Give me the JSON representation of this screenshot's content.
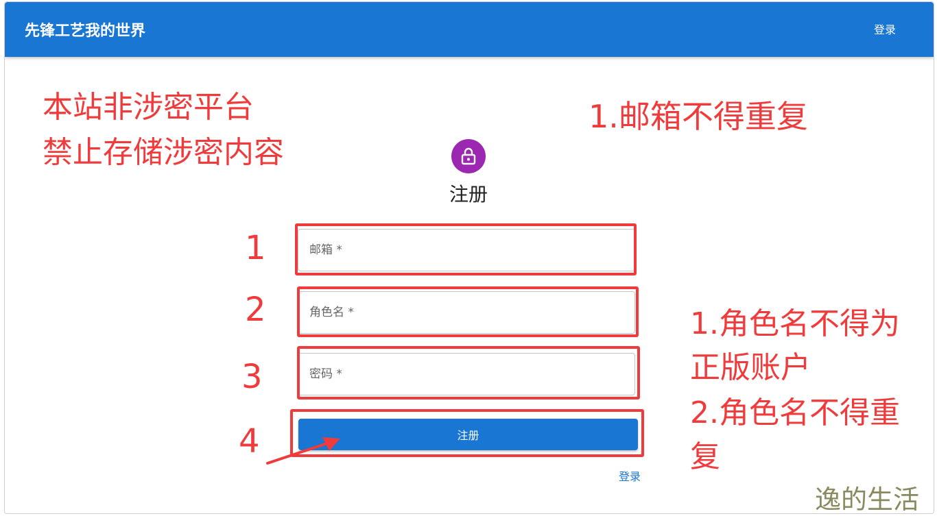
{
  "header": {
    "site_title": "先锋工艺我的世界",
    "login_link": "登录"
  },
  "form": {
    "title": "注册",
    "email_placeholder": "邮箱 *",
    "name_placeholder": "角色名 *",
    "password_placeholder": "密码 *",
    "submit_label": "注册",
    "login_link": "登录",
    "avatar_icon": "lock-icon"
  },
  "annotations": {
    "warning_line1": "本站非涉密平台",
    "warning_line2": "禁止存储涉密内容",
    "email_note": "1.邮箱不得重复",
    "name_note_line1": "1.角色名不得为",
    "name_note_line2": "正版账户",
    "name_note_line3": "2.角色名不得重",
    "name_note_line4": "复",
    "step1": "1",
    "step2": "2",
    "step3": "3",
    "step4": "4",
    "color": "#ef3b3b"
  },
  "watermark": "逸的生活",
  "colors": {
    "primary": "#1976d2",
    "avatar": "#9c27b0"
  }
}
